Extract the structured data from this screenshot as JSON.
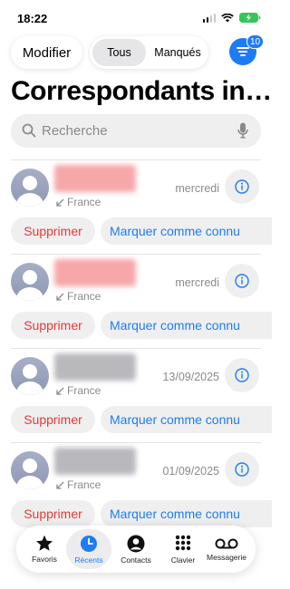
{
  "status": {
    "time": "18:22"
  },
  "toolbar": {
    "edit_label": "Modifier",
    "segments": [
      "Tous",
      "Manqués"
    ],
    "filter_badge": "10"
  },
  "page": {
    "title": "Correspondants in…"
  },
  "search": {
    "placeholder": "Recherche",
    "value": ""
  },
  "entries": [
    {
      "location": "France",
      "date": "mercredi",
      "name_style": "red",
      "delete_label": "Supprimer",
      "mark_label": "Marquer comme connu"
    },
    {
      "location": "France",
      "date": "mercredi",
      "name_style": "red",
      "delete_label": "Supprimer",
      "mark_label": "Marquer comme connu"
    },
    {
      "location": "France",
      "date": "13/09/2025",
      "name_style": "gray",
      "delete_label": "Supprimer",
      "mark_label": "Marquer comme connu"
    },
    {
      "location": "France",
      "date": "01/09/2025",
      "name_style": "gray",
      "delete_label": "Supprimer",
      "mark_label": "Marquer comme connu"
    }
  ],
  "tabs": [
    {
      "label": "Favoris",
      "icon": "star-icon",
      "active": false
    },
    {
      "label": "Récents",
      "icon": "clock-icon",
      "active": true
    },
    {
      "label": "Contacts",
      "icon": "person-icon",
      "active": false
    },
    {
      "label": "Clavier",
      "icon": "keypad-icon",
      "active": false
    },
    {
      "label": "Messagerie",
      "icon": "voicemail-icon",
      "active": false
    }
  ],
  "colors": {
    "accent": "#1e7cf2",
    "destructive": "#e53935",
    "secondary_text": "#8a8a8e"
  }
}
